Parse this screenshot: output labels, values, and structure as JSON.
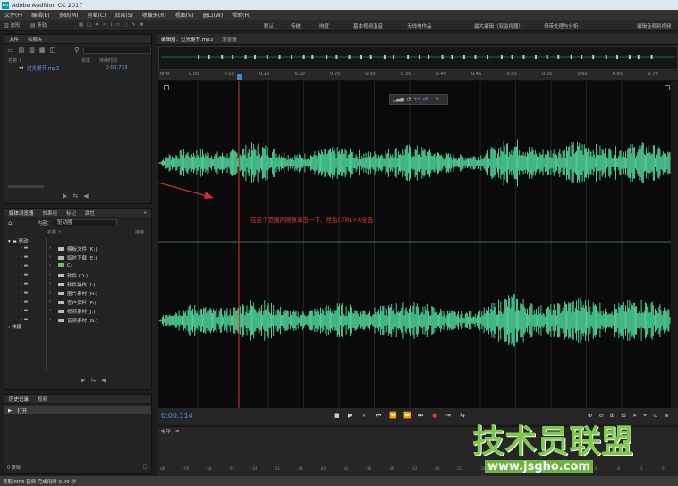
{
  "window": {
    "title": "Adobe Audition CC 2017"
  },
  "menu": [
    "文件(F)",
    "编辑(E)",
    "多轨(M)",
    "剪辑(C)",
    "效果(S)",
    "收藏夹(R)",
    "视图(V)",
    "窗口(W)",
    "帮助(H)"
  ],
  "toolbar": {
    "waveform_label": "波形",
    "multitrack_label": "多轨",
    "workspaces": [
      "默认",
      "传统",
      "响度",
      "基本视频混音",
      "无线电作品",
      "最大编辑（双监视器）",
      "母带处理与分析",
      "",
      "编辑音频到视频"
    ]
  },
  "files_panel": {
    "tabs": [
      "文件",
      "收藏夹"
    ],
    "columns": {
      "name": "名称 ↑",
      "status": "状态",
      "duration": "持续时间"
    },
    "files": [
      {
        "name": "过光棍节.mp3",
        "duration": "0:00.733"
      }
    ]
  },
  "media_browser": {
    "tabs": [
      "媒体浏览器",
      "效果组",
      "标记",
      "属性"
    ],
    "content_label": "内容：",
    "content_value": "驱动器",
    "columns": {
      "name": "名称 ↑",
      "duration": "持续"
    },
    "left_nodes": [
      "驱动",
      "快捷"
    ],
    "drives": [
      "模板文件 (K:)",
      "临时下载 (E:)",
      "C:",
      "软件 (D:)",
      "软件操作 (I:)",
      "图片素材 (H:)",
      "客户资料 (F:)",
      "视频素材 (J:)",
      "音频素材 (G:)"
    ]
  },
  "history_panel": {
    "tabs": [
      "历史记录",
      "视频"
    ],
    "items": [
      "打开"
    ],
    "undo_count": "0 撤销"
  },
  "editor": {
    "tabs": [
      "编辑器：过光棍节.mp3",
      "混音器"
    ],
    "ruler_unit": "hms",
    "ruler_ticks": [
      "0.05",
      "0.10",
      "0.15",
      "0.20",
      "0.25",
      "0.30",
      "0.35",
      "0.40",
      "0.45",
      "0.50",
      "0.55",
      "0.60",
      "0.65",
      "0.70"
    ],
    "hud_gain": "+0 dB",
    "annotation": "在这个范围内随意单击一下、然后CTRL+A全选",
    "current_time": "0:00.114"
  },
  "levels_panel": {
    "title": "电平",
    "scale": [
      "dB",
      "-59",
      "-58",
      "-57",
      "-54",
      "-51",
      "-48",
      "-45",
      "-42",
      "-39",
      "-36",
      "-33",
      "-30",
      "-27",
      "-24",
      "-21",
      "-18",
      "-15",
      "-12",
      "-9",
      "-6",
      "-3",
      "0"
    ]
  },
  "status_bar": {
    "text": "读取 MP3 音频 完成用时 0.00 秒"
  },
  "watermark": {
    "main": "技术员联盟",
    "url": "www.jsgho.com"
  },
  "colors": {
    "waveform": "#54e0a4",
    "playhead": "#d23030",
    "annotation": "#e23a3a",
    "timecode": "#5c8edc"
  }
}
